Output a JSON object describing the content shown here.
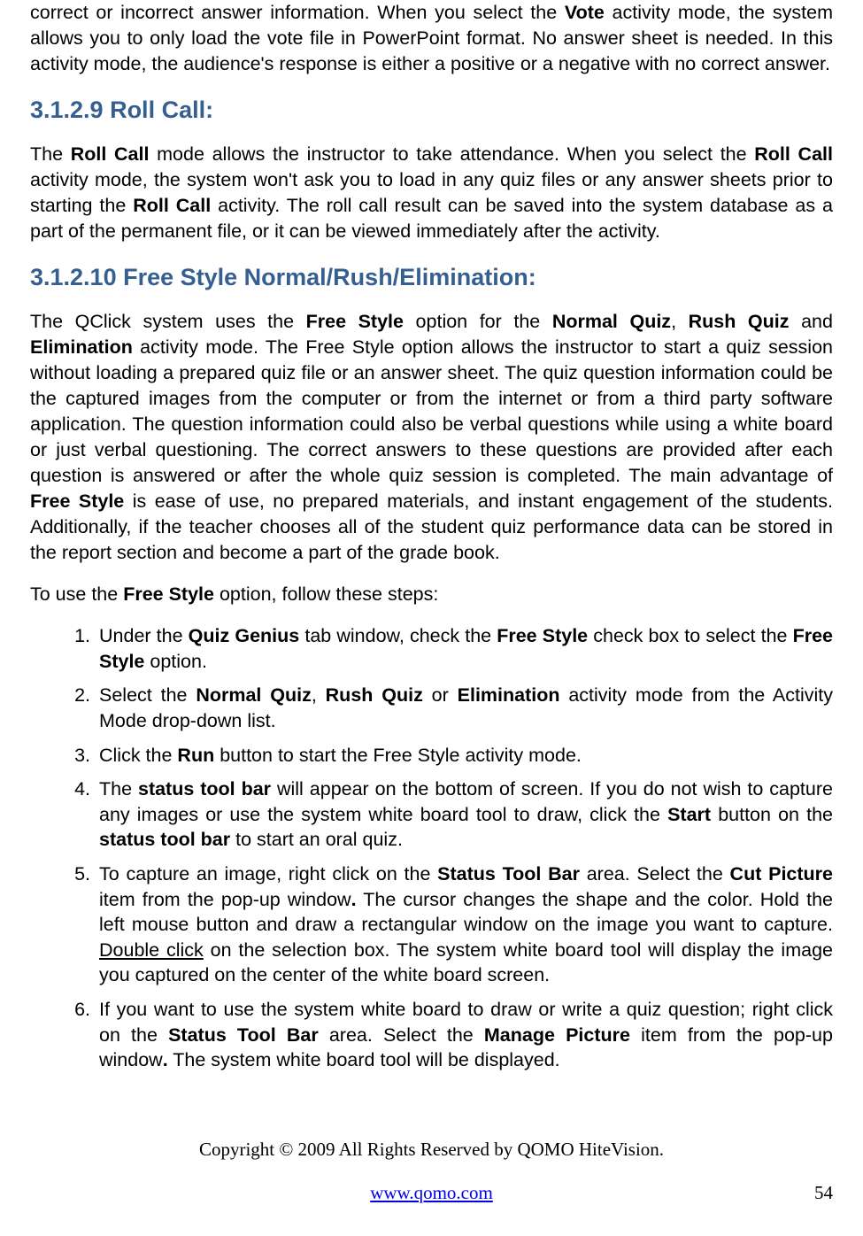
{
  "intro_paragraph_html": "correct or incorrect answer information. When you select the <b>Vote</b> activity mode, the system allows you to only load the vote file in PowerPoint format. No answer sheet is needed. In this activity mode, the audience's response is either a positive or a negative with no correct answer.",
  "section_rollcall": {
    "heading": "3.1.2.9 Roll Call:",
    "body_html": "The <b>Roll Call</b> mode allows the instructor to take attendance. When you select the <b>Roll Call</b> activity mode, the system won't ask you to load in any quiz files or any answer sheets prior to starting the <b>Roll Call</b> activity. The roll call result can be saved into the system database as a part of the permanent file, or it can be viewed immediately after the activity."
  },
  "section_freestyle": {
    "heading": "3.1.2.10  Free Style Normal/Rush/Elimination:",
    "body_html": "The QClick system uses the <b>Free Style</b> option for the <b>Normal Quiz</b>, <b>Rush Quiz</b> and <b>Elimination</b> activity mode. The Free Style option allows the instructor to start a quiz session without loading a prepared quiz file or an answer sheet. The quiz question information could be the captured images from the computer or from the internet or from a third party software application. The question information could also be verbal questions while using a white board or just verbal questioning. The correct answers to these questions are provided after each question is answered or after the whole quiz session is completed. The main advantage of <b>Free Style</b> is ease of use, no prepared materials, and instant engagement of the students. Additionally, if the teacher chooses all of the student quiz performance data can be stored in the report section and become a part of the grade book.",
    "intro_html": "To use the <b>Free Style</b> option, follow these steps:",
    "steps_html": [
      "Under the <b>Quiz Genius</b> tab window, check the <b>Free Style</b> check box to select the <b>Free Style</b> option.",
      "Select the <b>Normal Quiz</b>, <b>Rush Quiz</b> or <b>Elimination</b> activity mode from the Activity Mode drop-down list.",
      "Click the <b>Run</b> button to start the Free Style activity mode.",
      "The <b>status tool bar</b> will appear on the bottom of screen. If you do not wish to capture any images or use the system white board tool to draw, click the <b>Start</b> button on the <b>status tool bar</b> to start an oral quiz.",
      "To capture an image, right click on the <b>Status Tool Bar</b> area. Select the <b>Cut Picture</b> item from the pop-up window<b>.</b> The cursor changes the shape and the color. Hold the left mouse button and draw a rectangular window on the image you want to capture. <span class=\"u\">Double click</span> on the selection box. The system white board tool will display the image you captured on the center of the white board screen.",
      "If you want to use the system white board to draw or write a quiz question;  right click on the <b>Status Tool Bar</b> area. Select the <b>Manage Picture</b> item from the pop-up window<b>.</b> The system white board tool will be displayed."
    ]
  },
  "footer": {
    "copyright": "Copyright © 2009 All Rights Reserved by QOMO HiteVision.",
    "url": "www.qomo.com",
    "page_number": "54"
  }
}
